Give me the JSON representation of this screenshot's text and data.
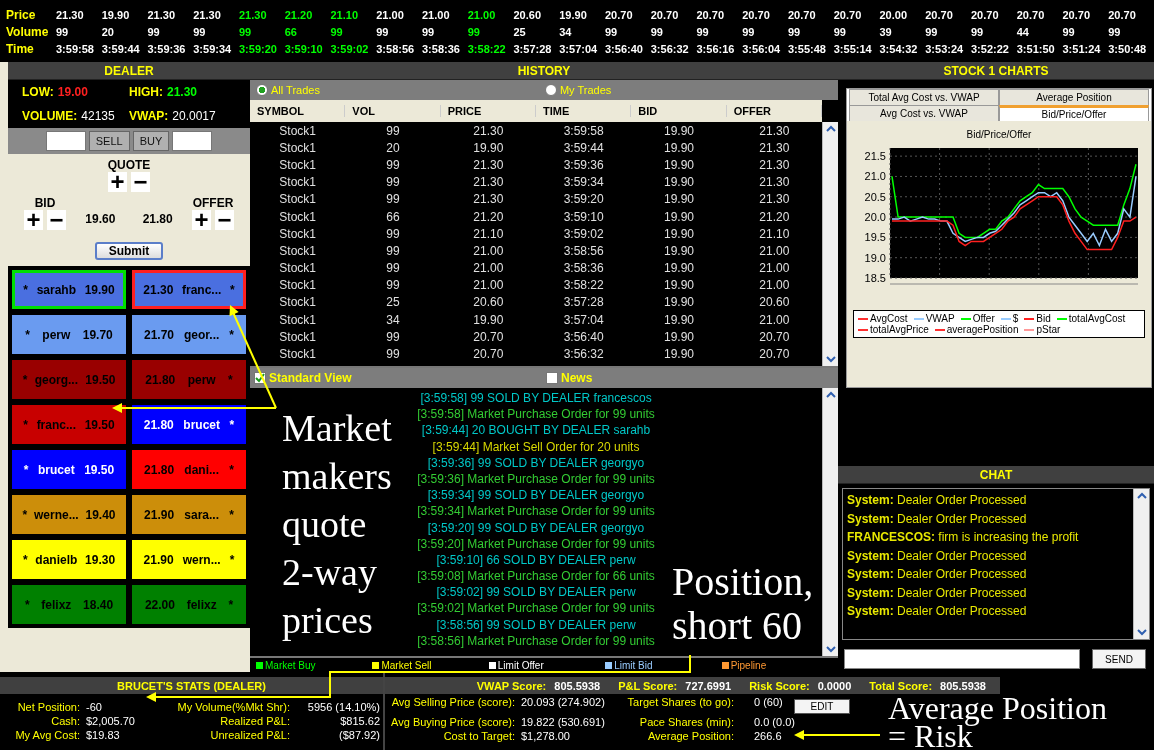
{
  "ticker": {
    "labels": [
      "Price",
      "Volume",
      "Time"
    ],
    "items": [
      {
        "price": "21.30",
        "volume": "99",
        "time": "3:59:58",
        "up": false
      },
      {
        "price": "19.90",
        "volume": "20",
        "time": "3:59:44",
        "up": false
      },
      {
        "price": "21.30",
        "volume": "99",
        "time": "3:59:36",
        "up": false
      },
      {
        "price": "21.30",
        "volume": "99",
        "time": "3:59:34",
        "up": false
      },
      {
        "price": "21.30",
        "volume": "99",
        "time": "3:59:20",
        "up": true
      },
      {
        "price": "21.20",
        "volume": "66",
        "time": "3:59:10",
        "up": true
      },
      {
        "price": "21.10",
        "volume": "99",
        "time": "3:59:02",
        "up": true
      },
      {
        "price": "21.00",
        "volume": "99",
        "time": "3:58:56",
        "up": false
      },
      {
        "price": "21.00",
        "volume": "99",
        "time": "3:58:36",
        "up": false
      },
      {
        "price": "21.00",
        "volume": "99",
        "time": "3:58:22",
        "up": true
      },
      {
        "price": "20.60",
        "volume": "25",
        "time": "3:57:28",
        "up": false
      },
      {
        "price": "19.90",
        "volume": "34",
        "time": "3:57:04",
        "up": false
      },
      {
        "price": "20.70",
        "volume": "99",
        "time": "3:56:40",
        "up": false
      },
      {
        "price": "20.70",
        "volume": "99",
        "time": "3:56:32",
        "up": false
      },
      {
        "price": "20.70",
        "volume": "99",
        "time": "3:56:16",
        "up": false
      },
      {
        "price": "20.70",
        "volume": "99",
        "time": "3:56:04",
        "up": false
      },
      {
        "price": "20.70",
        "volume": "99",
        "time": "3:55:48",
        "up": false
      },
      {
        "price": "20.70",
        "volume": "99",
        "time": "3:55:14",
        "up": false
      },
      {
        "price": "20.00",
        "volume": "39",
        "time": "3:54:32",
        "up": false
      },
      {
        "price": "20.70",
        "volume": "99",
        "time": "3:53:24",
        "up": false
      },
      {
        "price": "20.70",
        "volume": "99",
        "time": "3:52:22",
        "up": false
      },
      {
        "price": "20.70",
        "volume": "44",
        "time": "3:51:50",
        "up": false
      },
      {
        "price": "20.70",
        "volume": "99",
        "time": "3:51:24",
        "up": false
      },
      {
        "price": "20.70",
        "volume": "99",
        "time": "3:50:48",
        "up": false
      }
    ]
  },
  "dealer": {
    "title": "DEALER",
    "stats": [
      {
        "label": "LOW:",
        "value": "19.00",
        "color": "#ff2020"
      },
      {
        "label": "HIGH:",
        "value": "21.30",
        "color": "#00ff00"
      },
      {
        "label": "VOLUME:",
        "value": "42135",
        "color": "#ffffff"
      },
      {
        "label": "VWAP:",
        "value": "20.0017",
        "color": "#ffffff"
      }
    ],
    "sell_button": "SELL",
    "buy_button": "BUY",
    "quote_label": "QUOTE",
    "bid_label": "BID",
    "offer_label": "OFFER",
    "plus": "+",
    "minus": "−",
    "bid_value": "19.60",
    "offer_value": "21.80",
    "submit": "Submit",
    "bids": [
      {
        "star": "*",
        "name": "sarahb",
        "price": "19.90",
        "color": "#4a6fe0",
        "light_text": false,
        "selected": true
      },
      {
        "star": "*",
        "name": "perw",
        "price": "19.70",
        "color": "#6a9bf0",
        "light_text": false,
        "selected": false
      },
      {
        "star": "*",
        "name": "georg...",
        "price": "19.50",
        "color": "#990000",
        "light_text": false,
        "selected": false
      },
      {
        "star": "*",
        "name": "franc...",
        "price": "19.50",
        "color": "#c80000",
        "light_text": false,
        "selected": false
      },
      {
        "star": "*",
        "name": "brucet",
        "price": "19.50",
        "color": "#0000ff",
        "light_text": true,
        "selected": false
      },
      {
        "star": "*",
        "name": "werne...",
        "price": "19.40",
        "color": "#cc8e0a",
        "light_text": false,
        "selected": false
      },
      {
        "star": "*",
        "name": "danielb",
        "price": "19.30",
        "color": "#ffff00",
        "light_text": false,
        "selected": false
      },
      {
        "star": "*",
        "name": "felixz",
        "price": "18.40",
        "color": "#008000",
        "light_text": false,
        "selected": false
      }
    ],
    "offers": [
      {
        "star": "*",
        "name": "franc...",
        "price": "21.30",
        "color": "#4a6fe0",
        "light_text": false,
        "selected": true
      },
      {
        "star": "*",
        "name": "geor...",
        "price": "21.70",
        "color": "#6a9bf0",
        "light_text": false,
        "selected": false
      },
      {
        "star": "*",
        "name": "perw",
        "price": "21.80",
        "color": "#990000",
        "light_text": false,
        "selected": false
      },
      {
        "star": "*",
        "name": "brucet",
        "price": "21.80",
        "color": "#0000ff",
        "light_text": true,
        "selected": false
      },
      {
        "star": "*",
        "name": "dani...",
        "price": "21.80",
        "color": "#ff0000",
        "light_text": false,
        "selected": false
      },
      {
        "star": "*",
        "name": "sara...",
        "price": "21.90",
        "color": "#cc8e0a",
        "light_text": false,
        "selected": false
      },
      {
        "star": "*",
        "name": "wern...",
        "price": "21.90",
        "color": "#ffff00",
        "light_text": false,
        "selected": false
      },
      {
        "star": "*",
        "name": "felixz",
        "price": "22.00",
        "color": "#008000",
        "light_text": false,
        "selected": false
      }
    ]
  },
  "history": {
    "title": "HISTORY",
    "filters": [
      {
        "label": "All Trades",
        "selected": true
      },
      {
        "label": "My Trades",
        "selected": false
      }
    ],
    "columns": [
      "SYMBOL",
      "VOL",
      "PRICE",
      "TIME",
      "BID",
      "OFFER"
    ],
    "rows": [
      [
        "Stock1",
        "99",
        "21.30",
        "3:59:58",
        "19.90",
        "21.30"
      ],
      [
        "Stock1",
        "20",
        "19.90",
        "3:59:44",
        "19.90",
        "21.30"
      ],
      [
        "Stock1",
        "99",
        "21.30",
        "3:59:36",
        "19.90",
        "21.30"
      ],
      [
        "Stock1",
        "99",
        "21.30",
        "3:59:34",
        "19.90",
        "21.30"
      ],
      [
        "Stock1",
        "99",
        "21.30",
        "3:59:20",
        "19.90",
        "21.30"
      ],
      [
        "Stock1",
        "66",
        "21.20",
        "3:59:10",
        "19.90",
        "21.20"
      ],
      [
        "Stock1",
        "99",
        "21.10",
        "3:59:02",
        "19.90",
        "21.10"
      ],
      [
        "Stock1",
        "99",
        "21.00",
        "3:58:56",
        "19.90",
        "21.00"
      ],
      [
        "Stock1",
        "99",
        "21.00",
        "3:58:36",
        "19.90",
        "21.00"
      ],
      [
        "Stock1",
        "99",
        "21.00",
        "3:58:22",
        "19.90",
        "21.00"
      ],
      [
        "Stock1",
        "25",
        "20.60",
        "3:57:28",
        "19.90",
        "20.60"
      ],
      [
        "Stock1",
        "34",
        "19.90",
        "3:57:04",
        "19.90",
        "21.00"
      ],
      [
        "Stock1",
        "99",
        "20.70",
        "3:56:40",
        "19.90",
        "20.70"
      ],
      [
        "Stock1",
        "99",
        "20.70",
        "3:56:32",
        "19.90",
        "20.70"
      ]
    ],
    "views": [
      {
        "label": "Standard View",
        "checked": true
      },
      {
        "label": "News",
        "checked": false
      }
    ],
    "log": [
      {
        "text": "[3:59:58] 99 SOLD BY DEALER francescos",
        "color": "#00c8c8"
      },
      {
        "text": "[3:59:58] Market Purchase Order for 99 units",
        "color": "#33cc33"
      },
      {
        "text": "[3:59:44] 20 BOUGHT BY DEALER sarahb",
        "color": "#00c8c8"
      },
      {
        "text": "[3:59:44] Market Sell Order for 20 units",
        "color": "#d8d800"
      },
      {
        "text": "[3:59:36] 99 SOLD BY DEALER georgyo",
        "color": "#00c8c8"
      },
      {
        "text": "[3:59:36] Market Purchase Order for 99 units",
        "color": "#33cc33"
      },
      {
        "text": "[3:59:34] 99 SOLD BY DEALER georgyo",
        "color": "#00c8c8"
      },
      {
        "text": "[3:59:34] Market Purchase Order for 99 units",
        "color": "#33cc33"
      },
      {
        "text": "[3:59:20] 99 SOLD BY DEALER georgyo",
        "color": "#00c8c8"
      },
      {
        "text": "[3:59:20] Market Purchase Order for 99 units",
        "color": "#33cc33"
      },
      {
        "text": "[3:59:10] 66 SOLD BY DEALER perw",
        "color": "#00c8c8"
      },
      {
        "text": "[3:59:08] Market Purchase Order for 66 units",
        "color": "#33cc33"
      },
      {
        "text": "[3:59:02] 99 SOLD BY DEALER perw",
        "color": "#00c8c8"
      },
      {
        "text": "[3:59:02] Market Purchase Order for 99 units",
        "color": "#33cc33"
      },
      {
        "text": "[3:58:56] 99 SOLD BY DEALER perw",
        "color": "#00c8c8"
      },
      {
        "text": "[3:58:56] Market Purchase Order for 99 units",
        "color": "#33cc33"
      }
    ],
    "legend": [
      {
        "label": "Market Buy",
        "color": "#00ff00"
      },
      {
        "label": "Market Sell",
        "color": "#ffff00"
      },
      {
        "label": "Limit Offer",
        "color": "#ffffff"
      },
      {
        "label": "Limit Bid",
        "color": "#99ccff"
      },
      {
        "label": "Pipeline",
        "color": "#ff9933"
      }
    ]
  },
  "charts": {
    "title": "STOCK 1 CHARTS",
    "tabs_back": [
      {
        "label": "Total Avg Cost vs. VWAP",
        "selected": false
      },
      {
        "label": "Average Position",
        "selected": false
      }
    ],
    "tabs_front": [
      {
        "label": "Avg Cost vs. VWAP",
        "selected": false
      },
      {
        "label": "Bid/Price/Offer",
        "selected": true
      }
    ],
    "chart_data": {
      "type": "line",
      "grid": true,
      "title": "Bid/Price/Offer",
      "ylim": [
        18.5,
        21.7
      ],
      "yticks": [
        18.5,
        {
          "value": 19,
          "label": "19.0"
        },
        19.5,
        {
          "value": 20,
          "label": "20.0"
        },
        20.5,
        {
          "value": 21,
          "label": "21.0"
        },
        21.5
      ],
      "series": [
        {
          "name": "AvgCost",
          "color": "#ff3030",
          "values": [
            null,
            null,
            null,
            null,
            null,
            null,
            null,
            null,
            null,
            null,
            null,
            null,
            null,
            null,
            null,
            null,
            null,
            null,
            null,
            null,
            null,
            null,
            null,
            null,
            null,
            null,
            null,
            null,
            null,
            null,
            null,
            null,
            null,
            null,
            null,
            null,
            null,
            null,
            null,
            null,
            null
          ]
        },
        {
          "name": "VWAP",
          "color": "#99ccff",
          "values": [
            null,
            null,
            null,
            null,
            null,
            null,
            null,
            null,
            null,
            null,
            null,
            null,
            null,
            null,
            null,
            null,
            null,
            null,
            null,
            null,
            null,
            null,
            null,
            null,
            null,
            null,
            null,
            null,
            null,
            null,
            null,
            null,
            null,
            null,
            null,
            null,
            null,
            null,
            null,
            null,
            null
          ]
        },
        {
          "name": "Offer",
          "color": "#00ff00",
          "values": [
            21.0,
            20.0,
            20.0,
            20.0,
            20.0,
            20.0,
            20.0,
            20.0,
            20.0,
            20.0,
            20.0,
            19.6,
            19.5,
            19.5,
            19.5,
            19.6,
            19.7,
            19.7,
            19.9,
            20.0,
            20.2,
            20.4,
            20.5,
            20.6,
            20.8,
            20.7,
            20.7,
            20.7,
            20.7,
            20.5,
            20.2,
            20.0,
            19.9,
            19.8,
            19.8,
            19.8,
            19.8,
            19.8,
            20.3,
            20.7,
            21.3
          ]
        },
        {
          "name": "$",
          "color": "#99ccff",
          "values": [
            19.95,
            19.95,
            20.0,
            19.9,
            19.95,
            20.0,
            19.95,
            19.95,
            19.9,
            19.9,
            19.6,
            19.5,
            19.4,
            19.45,
            19.5,
            19.5,
            19.6,
            19.65,
            19.8,
            19.95,
            20.1,
            20.3,
            20.4,
            20.5,
            20.6,
            20.6,
            20.5,
            20.6,
            20.4,
            20.0,
            19.8,
            19.6,
            19.4,
            19.6,
            19.3,
            19.7,
            19.4,
            19.6,
            20.2,
            20.0,
            21.0
          ]
        },
        {
          "name": "Bid",
          "color": "#ff2020",
          "values": [
            19.9,
            19.9,
            19.9,
            19.9,
            19.9,
            19.9,
            19.9,
            19.9,
            19.9,
            19.9,
            19.8,
            19.4,
            19.3,
            19.4,
            19.4,
            19.4,
            19.5,
            19.6,
            19.7,
            19.9,
            20.0,
            20.2,
            20.3,
            20.4,
            20.5,
            20.5,
            20.5,
            20.5,
            20.3,
            19.9,
            19.6,
            19.4,
            19.2,
            19.2,
            19.2,
            19.2,
            19.2,
            19.5,
            19.9,
            19.9,
            20.0
          ]
        },
        {
          "name": "totalAvgCost",
          "color": "#00ff00",
          "values": [
            null,
            null,
            null,
            null,
            null,
            null,
            null,
            null,
            null,
            null,
            null,
            null,
            null,
            null,
            null,
            null,
            null,
            null,
            null,
            null,
            null,
            null,
            null,
            null,
            null,
            null,
            null,
            null,
            null,
            null,
            null,
            null,
            null,
            null,
            null,
            null,
            null,
            null,
            null,
            null,
            null
          ]
        },
        {
          "name": "totalAvgPrice",
          "color": "#ff3030",
          "values": [
            null,
            null,
            null,
            null,
            null,
            null,
            null,
            null,
            null,
            null,
            null,
            null,
            null,
            null,
            null,
            null,
            null,
            null,
            null,
            null,
            null,
            null,
            null,
            null,
            null,
            null,
            null,
            null,
            null,
            null,
            null,
            null,
            null,
            null,
            null,
            null,
            null,
            null,
            null,
            null,
            null
          ]
        },
        {
          "name": "averagePosition",
          "color": "#ff3030",
          "values": [
            null,
            null,
            null,
            null,
            null,
            null,
            null,
            null,
            null,
            null,
            null,
            null,
            null,
            null,
            null,
            null,
            null,
            null,
            null,
            null,
            null,
            null,
            null,
            null,
            null,
            null,
            null,
            null,
            null,
            null,
            null,
            null,
            null,
            null,
            null,
            null,
            null,
            null,
            null,
            null,
            null
          ]
        },
        {
          "name": "pStar",
          "color": "#ff9999",
          "values": [
            null,
            null,
            null,
            null,
            null,
            null,
            null,
            null,
            null,
            null,
            null,
            null,
            null,
            null,
            null,
            null,
            null,
            null,
            null,
            null,
            null,
            null,
            null,
            null,
            null,
            null,
            null,
            null,
            null,
            null,
            null,
            null,
            null,
            null,
            null,
            null,
            null,
            null,
            null,
            null,
            null
          ]
        }
      ]
    }
  },
  "chat": {
    "title": "CHAT",
    "messages": [
      {
        "sender": "System:",
        "text": "Dealer Order Processed"
      },
      {
        "sender": "System:",
        "text": "Dealer Order Processed"
      },
      {
        "sender": "FRANCESCOS:",
        "text": "firm is increasing the profit"
      },
      {
        "sender": "System:",
        "text": "Dealer Order Processed"
      },
      {
        "sender": "System:",
        "text": "Dealer Order Processed"
      },
      {
        "sender": "System:",
        "text": "Dealer Order Processed"
      },
      {
        "sender": "System:",
        "text": "Dealer Order Processed"
      }
    ],
    "send": "SEND"
  },
  "stats": {
    "title": "BRUCET'S STATS (DEALER)",
    "left": [
      {
        "label": "Net Position:",
        "value": "-60"
      },
      {
        "label": "Cash:",
        "value": "$2,005.70"
      },
      {
        "label": "My Avg Cost:",
        "value": "$19.83"
      }
    ],
    "right": [
      {
        "label": "My Volume(%Mkt Shr):",
        "value": "5956 (14.10%)"
      },
      {
        "label": "Realized P&L:",
        "value": "$815.62"
      },
      {
        "label": "Unrealized P&L:",
        "value": "($87.92)"
      }
    ]
  },
  "scores": {
    "bar": [
      {
        "label": "VWAP Score:",
        "value": "805.5938"
      },
      {
        "label": "P&L Score:",
        "value": "727.6991"
      },
      {
        "label": "Risk Score:",
        "value": "0.0000"
      },
      {
        "label": "Total Score:",
        "value": "805.5938"
      }
    ],
    "left": [
      {
        "label": "Avg Selling Price (score):",
        "value": "20.093 (274.902)"
      },
      {
        "label": "Avg Buying Price (score):",
        "value": "19.822 (530.691)"
      },
      {
        "label": "Cost to Target:",
        "value": "$1,278.00"
      }
    ],
    "right": [
      {
        "label": "Target Shares (to go):",
        "value": "0 (60)"
      },
      {
        "label": "Pace Shares (min):",
        "value": "0.0 (0.0)"
      },
      {
        "label": "Average Position:",
        "value": "266.6"
      }
    ],
    "edit": "EDIT"
  },
  "annotations": [
    "Market makers quote 2-way prices",
    "Position, short 60",
    "Average Position = Risk"
  ]
}
